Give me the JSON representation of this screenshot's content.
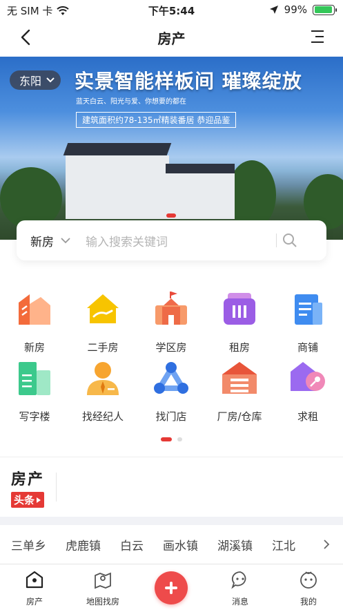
{
  "status_bar": {
    "carrier": "无 SIM 卡",
    "time": "下午5:44",
    "battery": "99%"
  },
  "nav": {
    "title": "房产"
  },
  "banner": {
    "city": "东阳",
    "headline": "实景智能样板间 璀璨绽放",
    "subline": "蓝天白云、阳光与爱、你想要的都在",
    "tag": "建筑面积约78-135㎡精装番居 恭迎品鉴"
  },
  "search": {
    "type": "新房",
    "placeholder": "输入搜索关键词"
  },
  "categories": [
    {
      "label": "新房",
      "icon": "new-house-icon"
    },
    {
      "label": "二手房",
      "icon": "second-hand-icon"
    },
    {
      "label": "学区房",
      "icon": "school-district-icon"
    },
    {
      "label": "租房",
      "icon": "rental-icon"
    },
    {
      "label": "商铺",
      "icon": "shop-icon"
    },
    {
      "label": "写字楼",
      "icon": "office-building-icon"
    },
    {
      "label": "找经纪人",
      "icon": "agent-icon"
    },
    {
      "label": "找门店",
      "icon": "store-icon"
    },
    {
      "label": "厂房/仓库",
      "icon": "warehouse-icon"
    },
    {
      "label": "求租",
      "icon": "seek-rent-icon"
    }
  ],
  "headline": {
    "title": "房产",
    "badge": "头条"
  },
  "towns": [
    "三单乡",
    "虎鹿镇",
    "白云",
    "画水镇",
    "湖溪镇",
    "江北"
  ],
  "tabbar": [
    {
      "label": "房产",
      "icon": "home-tab-icon"
    },
    {
      "label": "地图找房",
      "icon": "map-tab-icon"
    },
    {
      "label": "消息",
      "icon": "message-tab-icon"
    },
    {
      "label": "我的",
      "icon": "profile-tab-icon"
    }
  ],
  "colors": {
    "accent": "#e53935",
    "battery": "#34c759"
  }
}
